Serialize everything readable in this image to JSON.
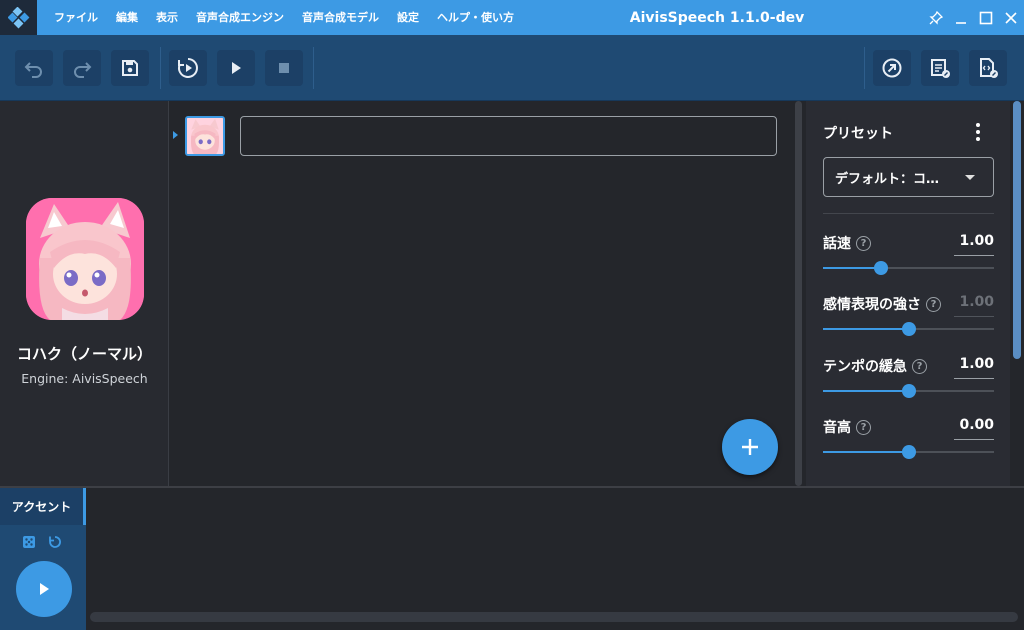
{
  "window": {
    "title": "AivisSpeech 1.1.0-dev"
  },
  "menu": [
    {
      "label": "ファイル"
    },
    {
      "label": "編集"
    },
    {
      "label": "表示"
    },
    {
      "label": "音声合成エンジン"
    },
    {
      "label": "音声合成モデル"
    },
    {
      "label": "設定"
    },
    {
      "label": "ヘルプ・使い方"
    }
  ],
  "toolbar": {
    "left": [
      "undo-icon",
      "redo-icon",
      "save-icon",
      "play-continuously-icon",
      "play-icon",
      "stop-icon"
    ],
    "right": [
      "export-audio-icon",
      "export-text-icon",
      "export-file-icon"
    ]
  },
  "character": {
    "name": "コハク（ノーマル）",
    "engine": "Engine: AivisSpeech"
  },
  "editor": {
    "text_value": "",
    "text_placeholder": ""
  },
  "preset": {
    "title": "プリセット",
    "selected": "デフォルト：コ…",
    "params": [
      {
        "label": "話速",
        "value": "1.00",
        "level": 0.34,
        "dim": false
      },
      {
        "label": "感情表現の強さ",
        "value": "1.00",
        "level": 0.5,
        "dim": true
      },
      {
        "label": "テンポの緩急",
        "value": "1.00",
        "level": 0.5,
        "dim": false
      },
      {
        "label": "音高",
        "value": "0.00",
        "level": 0.5,
        "dim": false
      }
    ]
  },
  "accent": {
    "tab_label": "アクセント"
  },
  "colors": {
    "accent": "#3d9ae4",
    "titlebar": "#3d9ae4",
    "toolbar": "#1f4a73",
    "background": "#24262b"
  }
}
